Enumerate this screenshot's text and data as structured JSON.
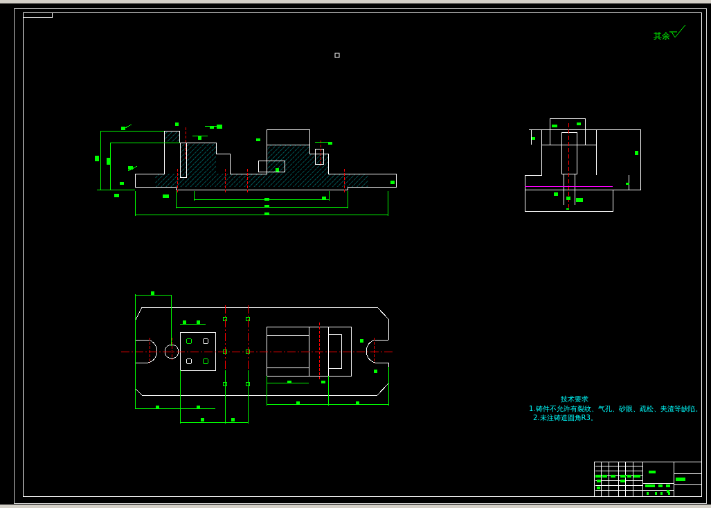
{
  "roughness_note": "其余",
  "technical_requirements": {
    "title": "技术要求",
    "items": [
      "1.铸件不允许有裂纹、气孔、砂眼、疏松、夹渣等缺陷。",
      "2.未注铸造圆角R3。"
    ]
  }
}
